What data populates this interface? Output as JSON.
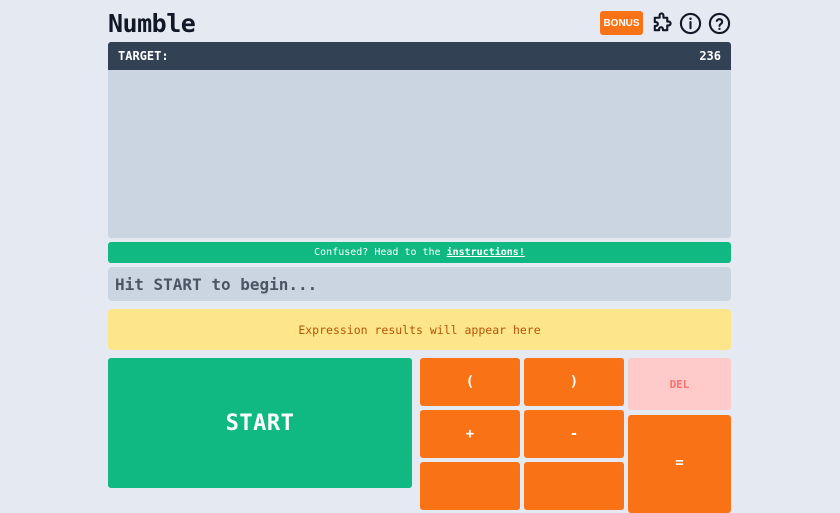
{
  "header": {
    "title": "Numble",
    "bonus_label": "BONUS",
    "icons": [
      "puzzle-icon",
      "info-icon",
      "help-icon"
    ]
  },
  "target": {
    "label": "TARGET:",
    "value": "236"
  },
  "help": {
    "text": "Confused? Head to the",
    "link_label": "instructions!"
  },
  "expression": {
    "placeholder": "Hit START to begin..."
  },
  "results": {
    "text": "Expression results will appear here"
  },
  "keypad": {
    "start_label": "START",
    "open_paren": "(",
    "close_paren": ")",
    "delete": "DEL",
    "plus": "+",
    "minus": "-",
    "equals": "="
  },
  "colors": {
    "accent_orange": "#f97316",
    "accent_green": "#10b981",
    "dark_bar": "#334155",
    "board": "#cbd5e1",
    "results_bg": "#fde68a"
  }
}
